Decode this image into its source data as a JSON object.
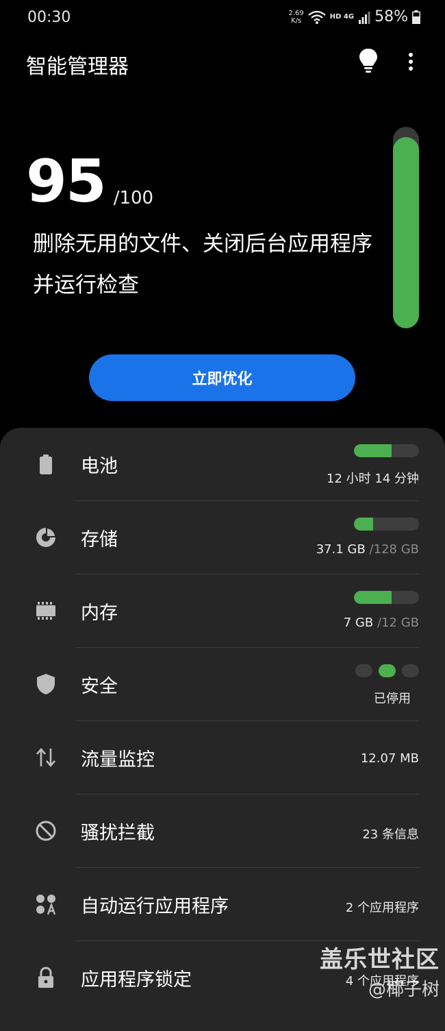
{
  "status_bar": {
    "time": "00:30",
    "speed_value": "2.69",
    "speed_unit": "K/s",
    "network": "HD 4G",
    "battery": "58%"
  },
  "app": {
    "title": "智能管理器",
    "icons": {
      "tips": "lightbulb-icon",
      "menu": "more-vert-icon"
    }
  },
  "score": {
    "value": "95",
    "max": "/100",
    "fraction": 0.95,
    "description": "删除无用的文件、关闭后台应用程序并运行检查"
  },
  "optimize_button": {
    "label": "立即优化"
  },
  "items": [
    {
      "id": "battery",
      "icon": "battery-icon",
      "label": "电池",
      "value": "12 小时 14 分钟",
      "value_dim": "",
      "fill": 0.58
    },
    {
      "id": "storage",
      "icon": "storage-pie-icon",
      "label": "存储",
      "value": "37.1 GB",
      "value_dim": " /128 GB",
      "fill": 0.29
    },
    {
      "id": "memory",
      "icon": "memory-chip-icon",
      "label": "内存",
      "value": "7 GB",
      "value_dim": " /12 GB",
      "fill": 0.58
    },
    {
      "id": "security",
      "icon": "shield-icon",
      "label": "安全",
      "value": "已停用",
      "value_dim": ""
    },
    {
      "id": "data",
      "icon": "data-transfer-icon",
      "label": "流量监控",
      "value": "12.07 MB",
      "value_dim": ""
    },
    {
      "id": "block",
      "icon": "block-icon",
      "label": "骚扰拦截",
      "value": "23 条信息",
      "value_dim": ""
    },
    {
      "id": "autorun",
      "icon": "auto-run-apps-icon",
      "label": "自动运行应用程序",
      "value": "2 个应用程序",
      "value_dim": ""
    },
    {
      "id": "applock",
      "icon": "lock-icon",
      "label": "应用程序锁定",
      "value": "4 个应用程序",
      "value_dim": ""
    }
  ],
  "colors": {
    "accent": "#1a73e8",
    "good": "#4caf50",
    "panel": "#262626",
    "track": "#3e3e3e"
  },
  "watermark": {
    "main": "盖乐世社区",
    "sub": "@椰子树"
  }
}
